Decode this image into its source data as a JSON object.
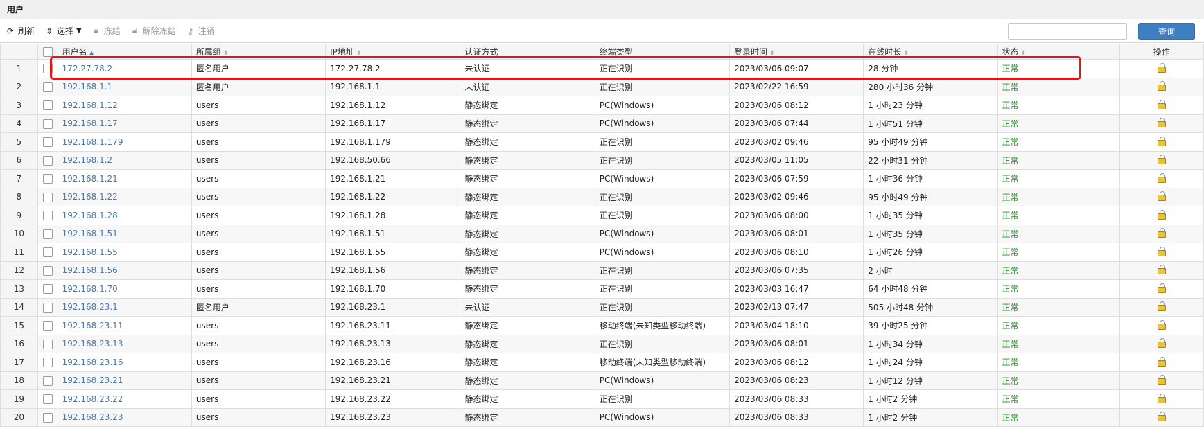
{
  "panel": {
    "title": "用户"
  },
  "toolbar": {
    "refresh_label": "刷新",
    "select_label": "选择",
    "freeze_label": "冻结",
    "unfreeze_label": "解除冻结",
    "logout_label": "注销",
    "search_placeholder": "",
    "query_label": "查询"
  },
  "table": {
    "columns": {
      "username": "用户名",
      "group": "所属组",
      "ip": "IP地址",
      "auth": "认证方式",
      "terminal": "终端类型",
      "login_time": "登录时间",
      "online": "在线时长",
      "status": "状态",
      "ops": "操作"
    },
    "rows": [
      {
        "n": "1",
        "user": "172.27.78.2",
        "group": "匿名用户",
        "ip": "172.27.78.2",
        "auth": "未认证",
        "terminal": "正在识别",
        "login": "2023/03/06 09:07",
        "online": "28 分钟",
        "status": "正常"
      },
      {
        "n": "2",
        "user": "192.168.1.1",
        "group": "匿名用户",
        "ip": "192.168.1.1",
        "auth": "未认证",
        "terminal": "正在识别",
        "login": "2023/02/22 16:59",
        "online": "280 小时36 分钟",
        "status": "正常"
      },
      {
        "n": "3",
        "user": "192.168.1.12",
        "group": "users",
        "ip": "192.168.1.12",
        "auth": "静态绑定",
        "terminal": "PC(Windows)",
        "login": "2023/03/06 08:12",
        "online": "1 小时23 分钟",
        "status": "正常"
      },
      {
        "n": "4",
        "user": "192.168.1.17",
        "group": "users",
        "ip": "192.168.1.17",
        "auth": "静态绑定",
        "terminal": "PC(Windows)",
        "login": "2023/03/06 07:44",
        "online": "1 小时51 分钟",
        "status": "正常"
      },
      {
        "n": "5",
        "user": "192.168.1.179",
        "group": "users",
        "ip": "192.168.1.179",
        "auth": "静态绑定",
        "terminal": "正在识别",
        "login": "2023/03/02 09:46",
        "online": "95 小时49 分钟",
        "status": "正常"
      },
      {
        "n": "6",
        "user": "192.168.1.2",
        "group": "users",
        "ip": "192.168.50.66",
        "auth": "静态绑定",
        "terminal": "正在识别",
        "login": "2023/03/05 11:05",
        "online": "22 小时31 分钟",
        "status": "正常"
      },
      {
        "n": "7",
        "user": "192.168.1.21",
        "group": "users",
        "ip": "192.168.1.21",
        "auth": "静态绑定",
        "terminal": "PC(Windows)",
        "login": "2023/03/06 07:59",
        "online": "1 小时36 分钟",
        "status": "正常"
      },
      {
        "n": "8",
        "user": "192.168.1.22",
        "group": "users",
        "ip": "192.168.1.22",
        "auth": "静态绑定",
        "terminal": "正在识别",
        "login": "2023/03/02 09:46",
        "online": "95 小时49 分钟",
        "status": "正常"
      },
      {
        "n": "9",
        "user": "192.168.1.28",
        "group": "users",
        "ip": "192.168.1.28",
        "auth": "静态绑定",
        "terminal": "正在识别",
        "login": "2023/03/06 08:00",
        "online": "1 小时35 分钟",
        "status": "正常"
      },
      {
        "n": "10",
        "user": "192.168.1.51",
        "group": "users",
        "ip": "192.168.1.51",
        "auth": "静态绑定",
        "terminal": "PC(Windows)",
        "login": "2023/03/06 08:01",
        "online": "1 小时35 分钟",
        "status": "正常"
      },
      {
        "n": "11",
        "user": "192.168.1.55",
        "group": "users",
        "ip": "192.168.1.55",
        "auth": "静态绑定",
        "terminal": "PC(Windows)",
        "login": "2023/03/06 08:10",
        "online": "1 小时26 分钟",
        "status": "正常"
      },
      {
        "n": "12",
        "user": "192.168.1.56",
        "group": "users",
        "ip": "192.168.1.56",
        "auth": "静态绑定",
        "terminal": "正在识别",
        "login": "2023/03/06 07:35",
        "online": "2 小时",
        "status": "正常"
      },
      {
        "n": "13",
        "user": "192.168.1.70",
        "group": "users",
        "ip": "192.168.1.70",
        "auth": "静态绑定",
        "terminal": "正在识别",
        "login": "2023/03/03 16:47",
        "online": "64 小时48 分钟",
        "status": "正常"
      },
      {
        "n": "14",
        "user": "192.168.23.1",
        "group": "匿名用户",
        "ip": "192.168.23.1",
        "auth": "未认证",
        "terminal": "正在识别",
        "login": "2023/02/13 07:47",
        "online": "505 小时48 分钟",
        "status": "正常"
      },
      {
        "n": "15",
        "user": "192.168.23.11",
        "group": "users",
        "ip": "192.168.23.11",
        "auth": "静态绑定",
        "terminal": "移动终端(未知类型移动终端)",
        "login": "2023/03/04 18:10",
        "online": "39 小时25 分钟",
        "status": "正常"
      },
      {
        "n": "16",
        "user": "192.168.23.13",
        "group": "users",
        "ip": "192.168.23.13",
        "auth": "静态绑定",
        "terminal": "正在识别",
        "login": "2023/03/06 08:01",
        "online": "1 小时34 分钟",
        "status": "正常"
      },
      {
        "n": "17",
        "user": "192.168.23.16",
        "group": "users",
        "ip": "192.168.23.16",
        "auth": "静态绑定",
        "terminal": "移动终端(未知类型移动终端)",
        "login": "2023/03/06 08:12",
        "online": "1 小时24 分钟",
        "status": "正常"
      },
      {
        "n": "18",
        "user": "192.168.23.21",
        "group": "users",
        "ip": "192.168.23.21",
        "auth": "静态绑定",
        "terminal": "PC(Windows)",
        "login": "2023/03/06 08:23",
        "online": "1 小时12 分钟",
        "status": "正常"
      },
      {
        "n": "19",
        "user": "192.168.23.22",
        "group": "users",
        "ip": "192.168.23.22",
        "auth": "静态绑定",
        "terminal": "正在识别",
        "login": "2023/03/06 08:33",
        "online": "1 小时2 分钟",
        "status": "正常"
      },
      {
        "n": "20",
        "user": "192.168.23.23",
        "group": "users",
        "ip": "192.168.23.23",
        "auth": "静态绑定",
        "terminal": "PC(Windows)",
        "login": "2023/03/06 08:33",
        "online": "1 小时2 分钟",
        "status": "正常"
      }
    ]
  },
  "colors": {
    "link": "#4a78a8",
    "status_ok": "#2e8a2e",
    "query_button": "#3e7fc1",
    "highlight": "#e61414"
  }
}
